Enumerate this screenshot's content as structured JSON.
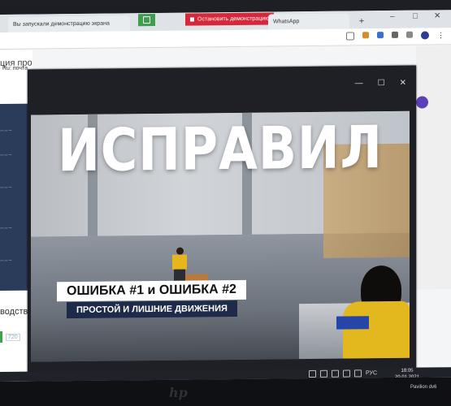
{
  "browser": {
    "tab_active": "Вы запускали демонстрацию экрана",
    "tab_whatsapp": "WhatsApp",
    "new_tab": "+",
    "share_stop": "Остановить демонстрацию",
    "win_min": "–",
    "win_max": "□",
    "win_close": "✕"
  },
  "page": {
    "bookmark": "Ru: почта",
    "title_fragment": "ция про",
    "production_fragment": "водства",
    "quality": "720",
    "file_fragment": "mp4"
  },
  "video_window": {
    "minimize": "—",
    "maximize": "☐",
    "close": "✕",
    "headline": "ИСПРАВИЛ",
    "label_errors": "ОШИБКА #1 и ОШИБКА #2",
    "label_sub": "ПРОСТОЙ  И ЛИШНИЕ ДВИЖЕНИЯ"
  },
  "taskbar": {
    "lang": "РУС",
    "time": "18:05",
    "date": "20.01.2021"
  },
  "monitor": {
    "brand": "hp",
    "model": "Pavilion dv6"
  },
  "colors": {
    "share_green": "#3f9e4c",
    "stop_red": "#d6283a",
    "label_navy": "#1e2a4a",
    "workwear_yellow": "#e2b81e"
  }
}
